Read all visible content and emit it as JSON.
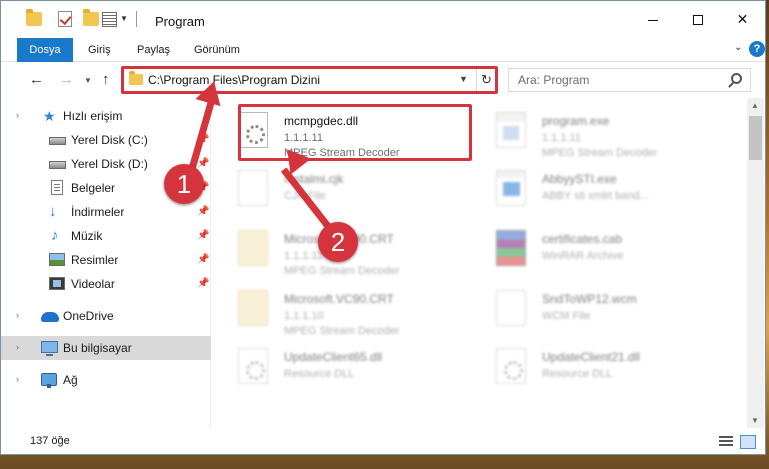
{
  "window": {
    "title": "Program",
    "controls": {
      "minimize": "",
      "maximize": "",
      "close": "✕"
    }
  },
  "ribbon": {
    "tabs": [
      "Dosya",
      "Giriş",
      "Paylaş",
      "Görünüm"
    ]
  },
  "nav": {
    "back": "←",
    "forward": "→",
    "up": "↑",
    "address": "C:\\Program Files\\Program Dizini",
    "refresh": "↻",
    "search_placeholder": "Ara: Program"
  },
  "sidebar": {
    "items": [
      {
        "label": "Hızlı erişim",
        "icon": "quick-access-star-icon",
        "pinned": false
      },
      {
        "label": "Yerel Disk (C:)",
        "icon": "drive-icon",
        "pinned": true
      },
      {
        "label": "Yerel Disk (D:)",
        "icon": "drive-icon",
        "pinned": true
      },
      {
        "label": "Belgeler",
        "icon": "documents-icon",
        "pinned": true
      },
      {
        "label": "İndirmeler",
        "icon": "downloads-icon",
        "pinned": true
      },
      {
        "label": "Müzik",
        "icon": "music-icon",
        "pinned": true
      },
      {
        "label": "Resimler",
        "icon": "pictures-icon",
        "pinned": true
      },
      {
        "label": "Videolar",
        "icon": "videos-icon",
        "pinned": true
      },
      {
        "label": "OneDrive",
        "icon": "onedrive-cloud-icon",
        "pinned": false
      },
      {
        "label": "Bu bilgisayar",
        "icon": "this-pc-icon",
        "pinned": false,
        "selected": true
      },
      {
        "label": "Ağ",
        "icon": "network-icon",
        "pinned": false
      }
    ]
  },
  "files": [
    {
      "name": "mcmpgdec.dll",
      "line1": "1.1.1.11",
      "line2": "MPEG Stream Decoder",
      "icon": "dll-gear-icon",
      "highlighted": true
    },
    {
      "name": "program.exe",
      "line1": "1.1.1.11",
      "line2": "MPEG Stream Decoder",
      "icon": "exe-icon"
    },
    {
      "name": "Instalmi.cjk",
      "line1": "CJK File",
      "line2": "",
      "icon": "generic-file-icon"
    },
    {
      "name": "AbbyySTI.exe",
      "line1": "ABBY sti xmlrt band...",
      "line2": "",
      "icon": "abbyy-exe-icon"
    },
    {
      "name": "Microsoft.VC90.CRT",
      "line1": "1.1.1.11",
      "line2": "MPEG Stream Decoder",
      "icon": "folder-file-icon"
    },
    {
      "name": "certificates.cab",
      "line1": "WinRAR Archive",
      "line2": "",
      "icon": "winrar-archive-icon"
    },
    {
      "name": "Microsoft.VC90.CRT",
      "line1": "1.1.1.10",
      "line2": "MPEG Stream Decoder",
      "icon": "folder-file-icon"
    },
    {
      "name": "SndToWP12.wcm",
      "line1": "WCM File",
      "line2": "",
      "icon": "generic-file-icon"
    },
    {
      "name": "UpdateClient65.dll",
      "line1": "Resource DLL",
      "line2": "",
      "icon": "dll-gear-icon"
    },
    {
      "name": "UpdateClient21.dll",
      "line1": "Resource DLL",
      "line2": "",
      "icon": "dll-gear-icon"
    }
  ],
  "status": {
    "count": "137 öğe"
  },
  "annotations": {
    "marker1": "1",
    "marker2": "2",
    "color": "#d6343c"
  },
  "colors": {
    "accent": "#1979ca",
    "selection": "#d9d9d9"
  }
}
